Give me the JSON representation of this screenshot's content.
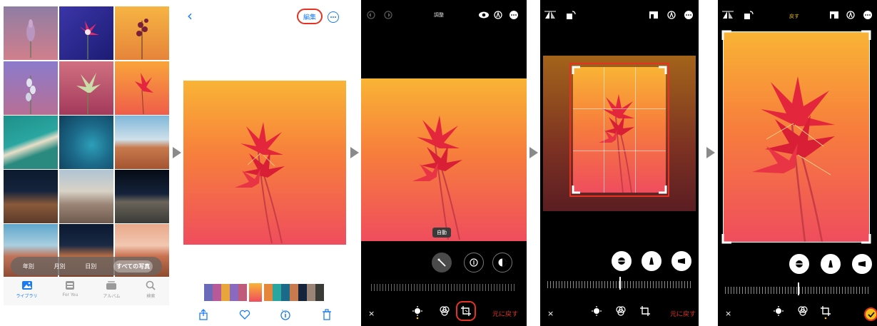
{
  "library": {
    "segments": [
      {
        "label": "年別",
        "active": false
      },
      {
        "label": "月別",
        "active": false
      },
      {
        "label": "日別",
        "active": false
      },
      {
        "label": "すべての写真",
        "active": true
      }
    ],
    "tabs": [
      {
        "label": "ライブラリ",
        "icon": "photo-library-icon",
        "active": true
      },
      {
        "label": "For You",
        "icon": "for-you-icon",
        "active": false
      },
      {
        "label": "アルバム",
        "icon": "album-icon",
        "active": false
      },
      {
        "label": "検索",
        "icon": "search-icon",
        "active": false
      }
    ]
  },
  "viewer": {
    "back_icon": "‹",
    "edit_label": "編集",
    "toolbar": [
      "share-icon",
      "heart-icon",
      "info-icon",
      "trash-icon"
    ]
  },
  "editor": {
    "title": "調整",
    "auto_label": "自動",
    "revert_label": "元に戻す",
    "close_label": "×"
  },
  "crop": {},
  "cropped": {
    "reset_label": "戻す",
    "close_label": "×"
  },
  "colors": {
    "accent_blue": "#1a7cf0",
    "highlight_red": "#e53222",
    "accent_yellow": "#f2c21b"
  }
}
